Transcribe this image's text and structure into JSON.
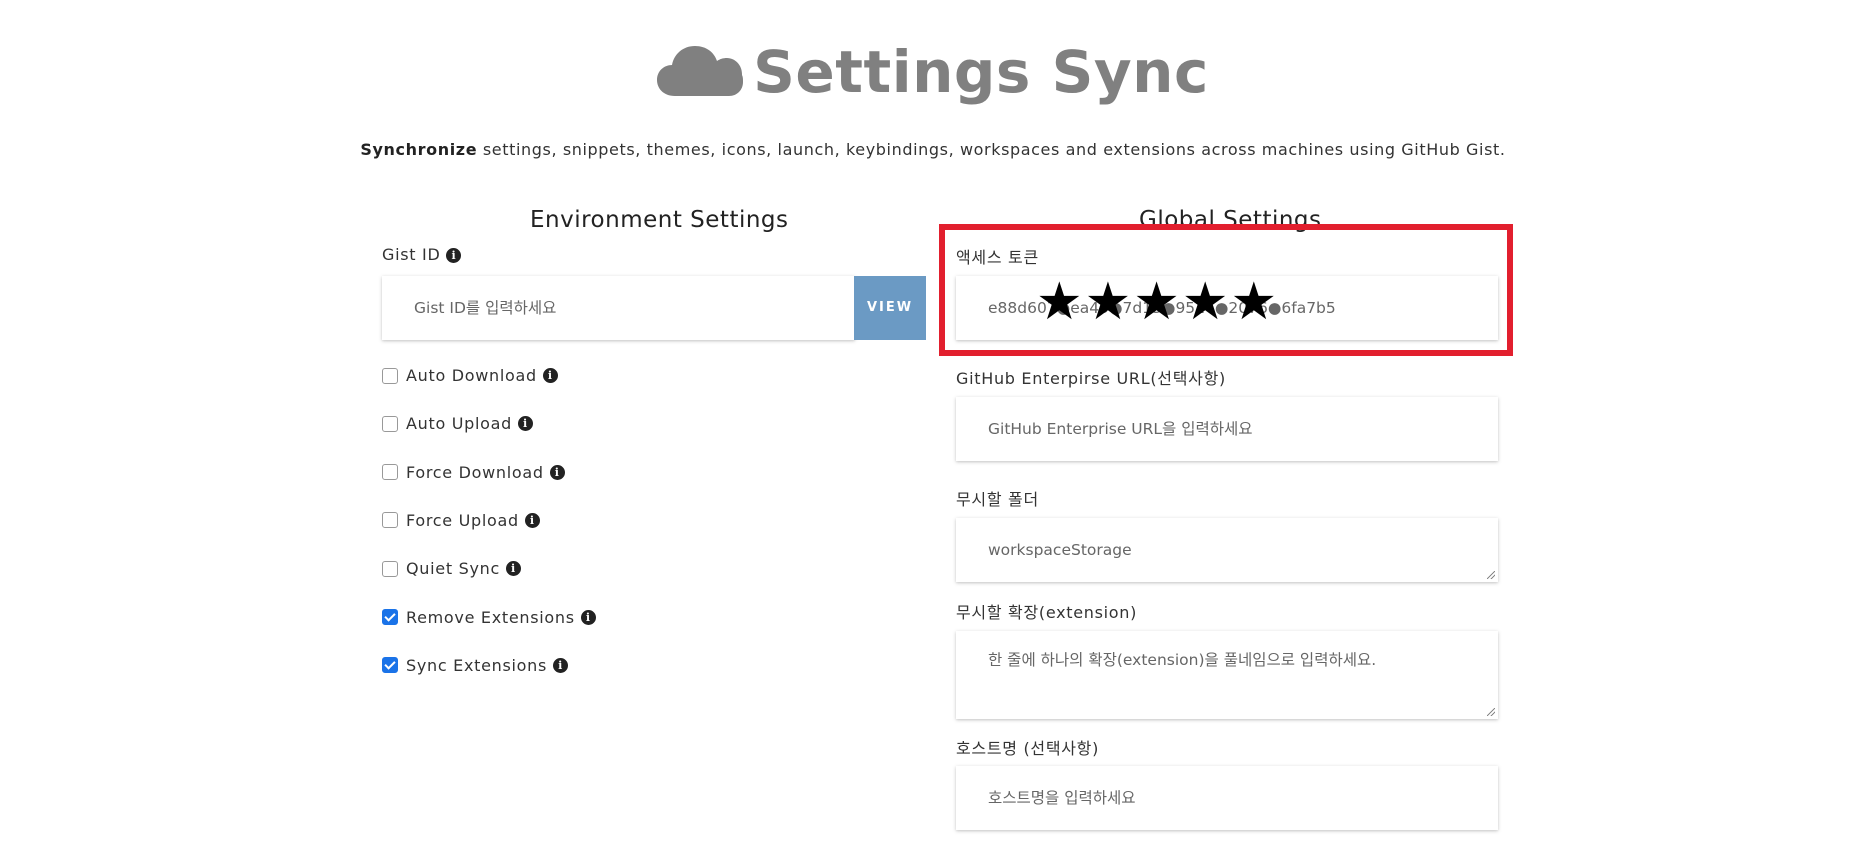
{
  "header": {
    "title": "Settings Sync",
    "subtitle_bold": "Synchronize",
    "subtitle_rest": " settings, snippets, themes, icons, launch, keybindings, workspaces and extensions across machines using GitHub Gist."
  },
  "environment": {
    "heading": "Environment Settings",
    "gist_label": "Gist ID",
    "gist_placeholder": "Gist ID를 입력하세요",
    "view_button": "VIEW",
    "options": [
      {
        "label": "Auto Download",
        "checked": false
      },
      {
        "label": "Auto Upload",
        "checked": false
      },
      {
        "label": "Force Download",
        "checked": false
      },
      {
        "label": "Force Upload",
        "checked": false
      },
      {
        "label": "Quiet Sync",
        "checked": false
      },
      {
        "label": "Remove Extensions",
        "checked": true
      },
      {
        "label": "Sync Extensions",
        "checked": true
      }
    ]
  },
  "global": {
    "heading": "Global Settings",
    "token_label": "액세스 토큰",
    "token_value": "e88d607●ea45●7d13●9514●2076●6fa7b5",
    "token_mask": "★★★★★",
    "enterprise_label": "GitHub Enterpirse URL(선택사항)",
    "enterprise_placeholder": "GitHub Enterprise URL을 입력하세요",
    "ignore_folder_label": "무시할 폴더",
    "ignore_folder_value": "workspaceStorage",
    "ignore_ext_label": "무시할 확장(extension)",
    "ignore_ext_placeholder": "한 줄에 하나의 확장(extension)을 풀네임으로 입력하세요.",
    "hostname_label": "호스트명 (선택사항)",
    "hostname_placeholder": "호스트명을 입력하세요"
  },
  "colors": {
    "accent": "#1a73e8",
    "view_button": "#6b9ac4",
    "highlight": "#e21f2e"
  }
}
